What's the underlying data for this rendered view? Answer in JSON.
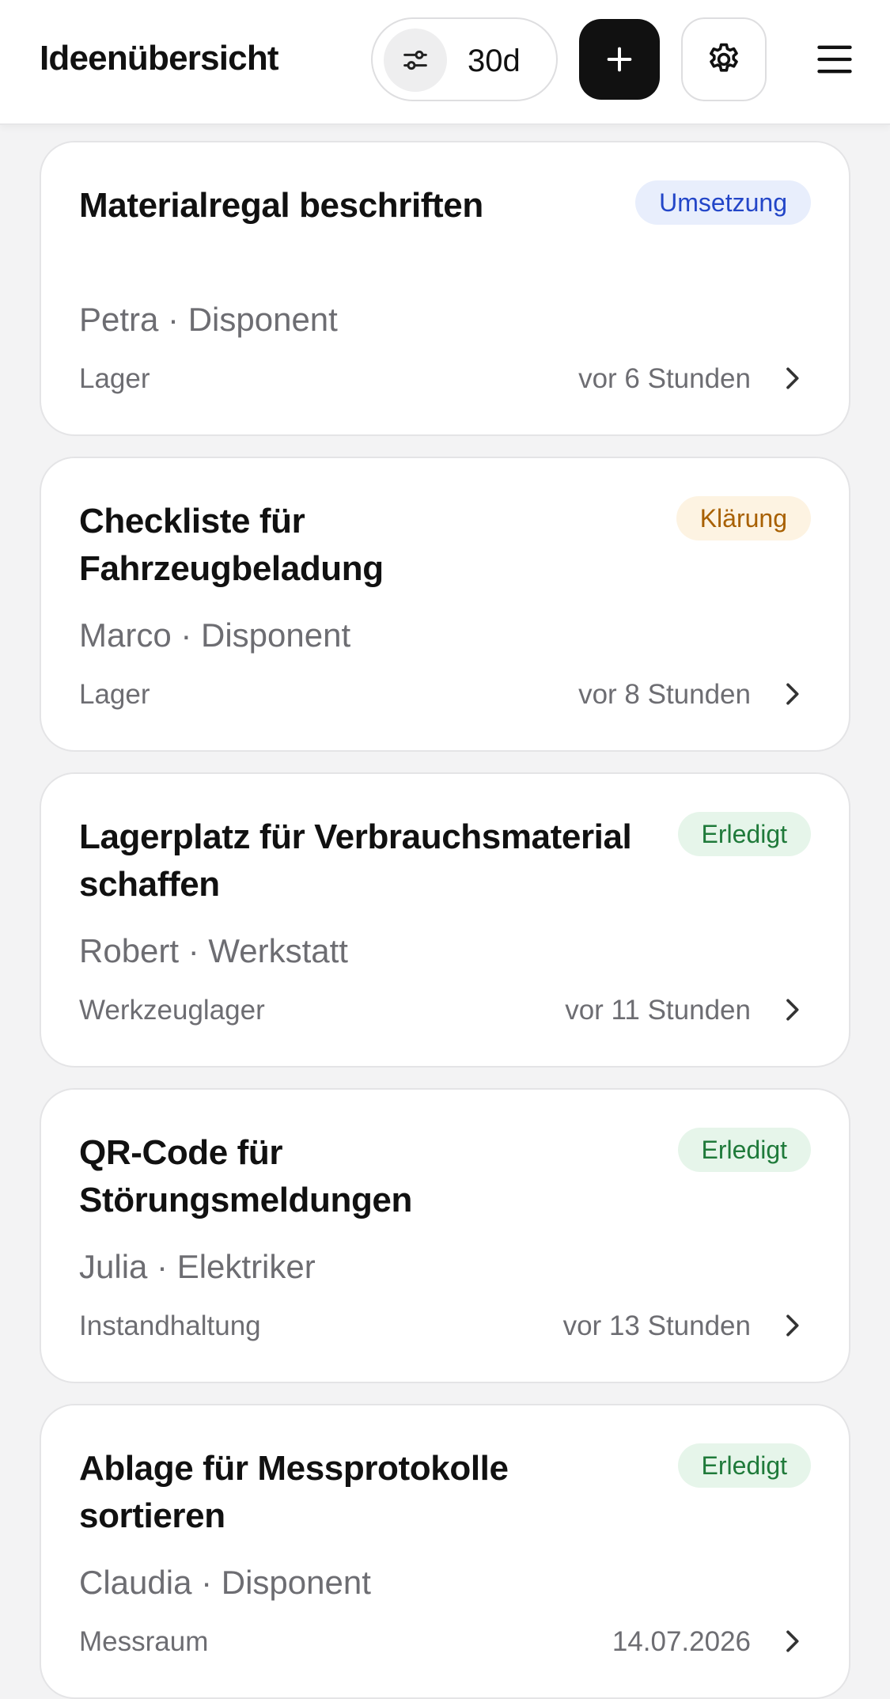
{
  "header": {
    "title": "Ideenübersicht",
    "filter_label": "30d",
    "icons": {
      "filter": "sliders-icon",
      "add": "plus-icon",
      "settings": "gear-icon",
      "menu": "hamburger-menu-icon"
    }
  },
  "colors": {
    "status_blue_bg": "#e8eefc",
    "status_blue_text": "#2346c8",
    "status_amber_bg": "#fdf3e2",
    "status_amber_text": "#a86000",
    "status_green_bg": "#e6f5ea",
    "status_green_text": "#1f7a3a"
  },
  "ideas": [
    {
      "title": "Materialregal beschriften",
      "status": "Umsetzung",
      "author": "Petra · Disponent",
      "area": "Lager",
      "time": "vor 6 Stunden"
    },
    {
      "title": "Checkliste für Fahrzeugbeladung",
      "status": "Klärung",
      "author": "Marco · Disponent",
      "area": "Lager",
      "time": "vor 8 Stunden"
    },
    {
      "title": "Lagerplatz für Verbrauchsmaterial schaffen",
      "status": "Erledigt",
      "author": "Robert · Werkstatt",
      "area": "Werkzeuglager",
      "time": "vor 11 Stunden"
    },
    {
      "title": "QR-Code für Störungsmeldungen",
      "status": "Erledigt",
      "author": "Julia · Elektriker",
      "area": "Instandhaltung",
      "time": "vor 13 Stunden"
    },
    {
      "title": "Ablage für Messprotokolle sortieren",
      "status": "Erledigt",
      "author": "Claudia · Disponent",
      "area": "Messraum",
      "time": "14.07.2026"
    }
  ]
}
